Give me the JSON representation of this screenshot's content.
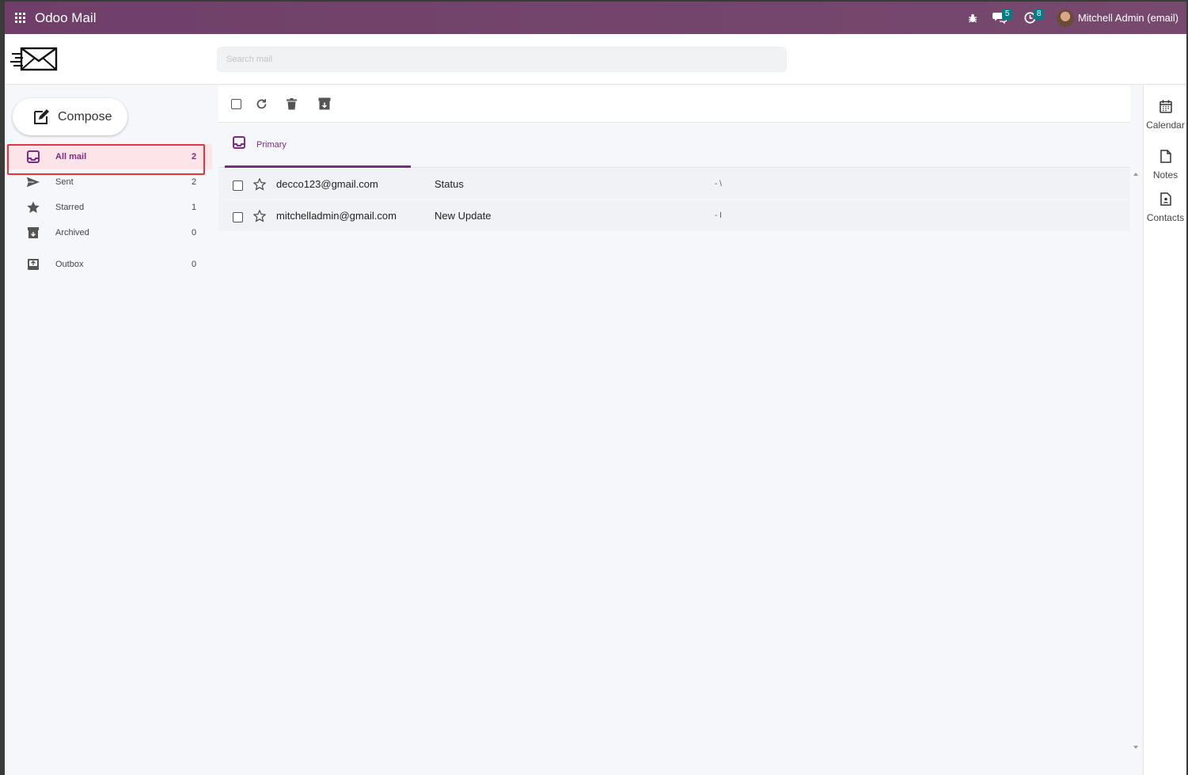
{
  "app": {
    "title": "Odoo Mail"
  },
  "systray": {
    "messages_count": "5",
    "activities_count": "8",
    "user_name": "Mitchell Admin (email)"
  },
  "search": {
    "placeholder": "Search mail"
  },
  "compose": {
    "label": "Compose"
  },
  "sidebar": {
    "items": [
      {
        "label": "All mail",
        "count": "2",
        "icon": "inbox-icon",
        "active": true
      },
      {
        "label": "Sent",
        "count": "2",
        "icon": "send-icon"
      },
      {
        "label": "Starred",
        "count": "1",
        "icon": "star-icon"
      },
      {
        "label": "Archived",
        "count": "0",
        "icon": "archive-icon"
      },
      {
        "label": "Outbox",
        "count": "0",
        "icon": "outbox-icon"
      }
    ]
  },
  "tabs": [
    {
      "label": "Primary",
      "icon": "inbox-icon"
    }
  ],
  "emails": [
    {
      "from": "decco123@gmail.com",
      "subject": "Status",
      "snippet": "- \\"
    },
    {
      "from": "mitchelladmin@gmail.com",
      "subject": "New Update",
      "snippet": "- I"
    }
  ],
  "right_panel": {
    "items": [
      {
        "label": "Calendar",
        "icon": "calendar-icon"
      },
      {
        "label": "Notes",
        "icon": "note-icon"
      },
      {
        "label": "Contacts",
        "icon": "contact-icon"
      }
    ]
  },
  "colors": {
    "topbar": "#714b67",
    "accent": "#7a2d82",
    "highlight_border": "#e8333b",
    "badge": "#017e84"
  }
}
